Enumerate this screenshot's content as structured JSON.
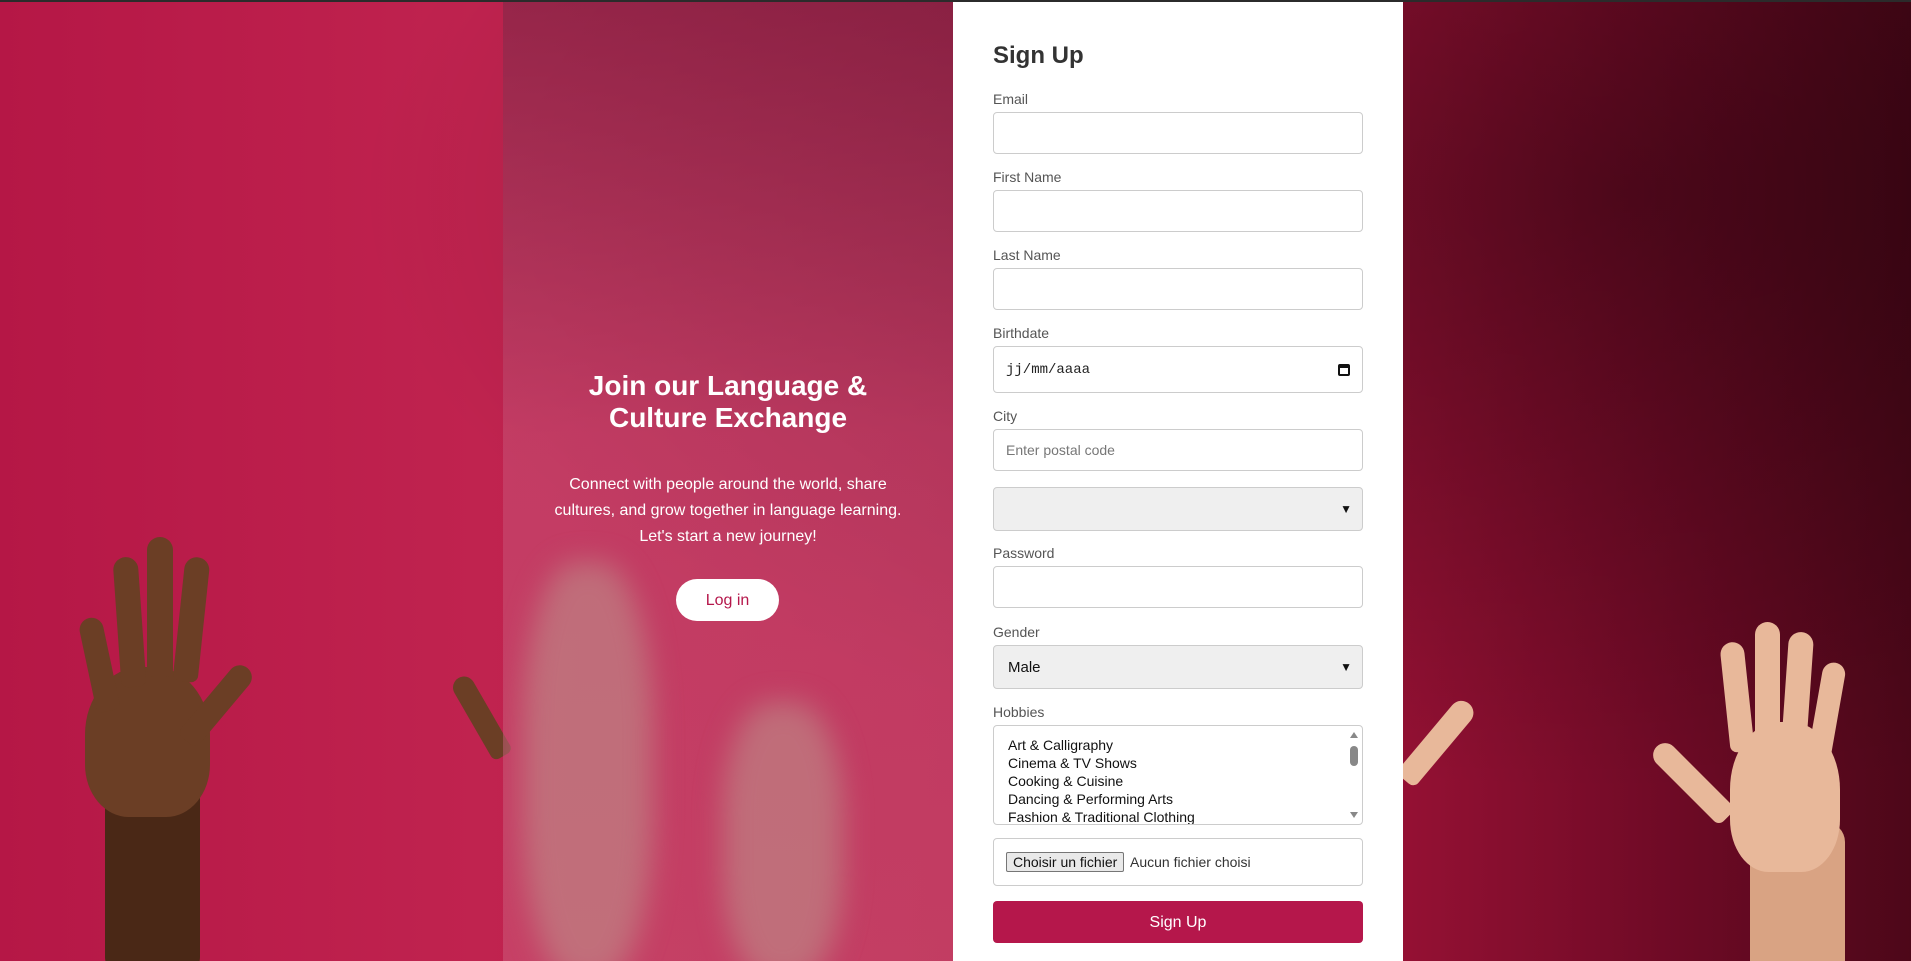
{
  "promo": {
    "title_line1": "Join our Language &",
    "title_line2": "Culture Exchange",
    "text_line1": "Connect with people around the world, share",
    "text_line2": "cultures, and grow together in language learning.",
    "text_line3": "Let's start a new journey!",
    "login_label": "Log in"
  },
  "form": {
    "title": "Sign Up",
    "email_label": "Email",
    "first_name_label": "First Name",
    "last_name_label": "Last Name",
    "birthdate_label": "Birthdate",
    "birthdate_placeholder": "jj/mm/aaaa",
    "city_label": "City",
    "city_placeholder": "Enter postal code",
    "city_select_value": "",
    "password_label": "Password",
    "gender_label": "Gender",
    "gender_value": "Male",
    "hobbies_label": "Hobbies",
    "hobbies": [
      "Art & Calligraphy",
      "Cinema & TV Shows",
      "Cooking & Cuisine",
      "Dancing & Performing Arts",
      "Fashion & Traditional Clothing"
    ],
    "file_button_label": "Choisir un fichier",
    "file_status": "Aucun fichier choisi",
    "submit_label": "Sign Up"
  },
  "colors": {
    "accent": "#b5174b",
    "background": "#c0234f"
  },
  "icons": {
    "calendar": "calendar-icon",
    "chevron": "chevron-down-icon"
  }
}
